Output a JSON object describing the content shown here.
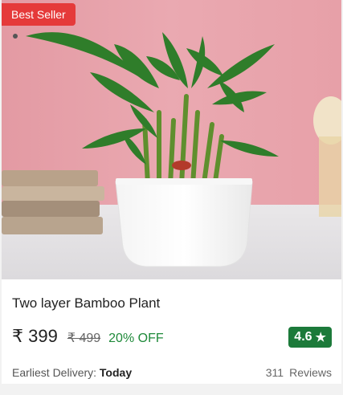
{
  "product": {
    "badge": "Best Seller",
    "title": "Two layer Bamboo Plant",
    "price": "₹ 399",
    "mrp": "₹ 499",
    "discount": "20% OFF",
    "rating": "4.6",
    "rating_icon": "star-icon",
    "delivery_label": "Earliest Delivery:",
    "delivery_value": "Today",
    "review_count": "311",
    "review_label": "Reviews",
    "image": "plant-in-white-pot-photo"
  },
  "colors": {
    "badge": "#e53a3a",
    "rating": "#1c7a3a",
    "discount": "#1f8a3a"
  }
}
